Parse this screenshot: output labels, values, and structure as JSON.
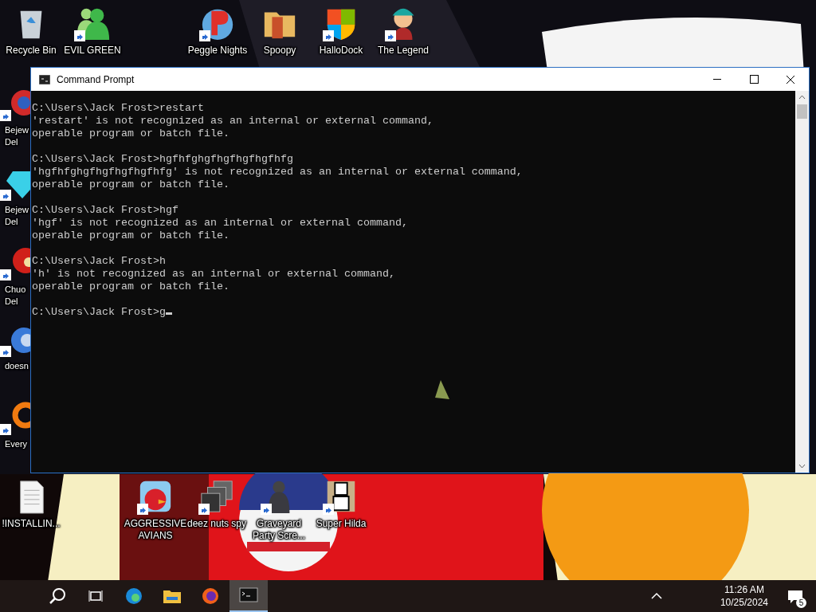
{
  "desktop_icons": [
    {
      "label": "Recycle Bin",
      "kind": "bin",
      "shortcut": false
    },
    {
      "label": "EVIL GREEN",
      "kind": "people",
      "shortcut": true
    },
    {
      "label": "Peggle Nights",
      "kind": "ball",
      "shortcut": true
    },
    {
      "label": "Spoopy",
      "kind": "folder",
      "shortcut": false
    },
    {
      "label": "HalloDock",
      "kind": "shield",
      "shortcut": true
    },
    {
      "label": "The Legend",
      "kind": "figure",
      "shortcut": true
    },
    {
      "label": "Bejew",
      "label2": "Del",
      "kind": "orb",
      "shortcut": true
    },
    {
      "label": "Bejew",
      "label2": "Del",
      "kind": "gem",
      "shortcut": true
    },
    {
      "label": "Chuo",
      "label2": "Del",
      "kind": "flower",
      "shortcut": true
    },
    {
      "label": "doesn",
      "kind": "drop",
      "shortcut": true
    },
    {
      "label": "Every",
      "kind": "ring",
      "shortcut": true
    },
    {
      "label": "!INSTALLIN...",
      "kind": "page",
      "shortcut": false
    },
    {
      "label": "AGGRESSIVE",
      "label2": "AVIANS",
      "kind": "bird",
      "shortcut": true
    },
    {
      "label": "deez nuts spy",
      "kind": "stack",
      "shortcut": true
    },
    {
      "label": "Graveyard",
      "label2": "Party Scre...",
      "kind": "dark",
      "shortcut": true
    },
    {
      "label": "Super Hilda",
      "kind": "pixel",
      "shortcut": true
    }
  ],
  "window": {
    "title": "Command Prompt",
    "blocks": [
      {
        "lines": [
          "C:\\Users\\Jack Frost>restart",
          "'restart' is not recognized as an internal or external command,",
          "operable program or batch file."
        ]
      },
      {
        "lines": [
          "C:\\Users\\Jack Frost>hgfhfghgfhgfhgfhgfhfg",
          "'hgfhfghgfhgfhgfhgfhfg' is not recognized as an internal or external command,",
          "operable program or batch file."
        ]
      },
      {
        "lines": [
          "C:\\Users\\Jack Frost>hgf",
          "'hgf' is not recognized as an internal or external command,",
          "operable program or batch file."
        ]
      },
      {
        "lines": [
          "C:\\Users\\Jack Frost>h",
          "'h' is not recognized as an internal or external command,",
          "operable program or batch file."
        ]
      },
      {
        "lines": [
          "C:\\Users\\Jack Frost>g"
        ],
        "cursor": true
      }
    ]
  },
  "taskbar": {
    "apps": [
      {
        "kind": "edge",
        "selected": false
      },
      {
        "kind": "explorer",
        "selected": false
      },
      {
        "kind": "firefox",
        "selected": false
      },
      {
        "kind": "terminal",
        "selected": true
      }
    ],
    "time": "11:26 AM",
    "date": "10/25/2024",
    "notifications": "5"
  }
}
